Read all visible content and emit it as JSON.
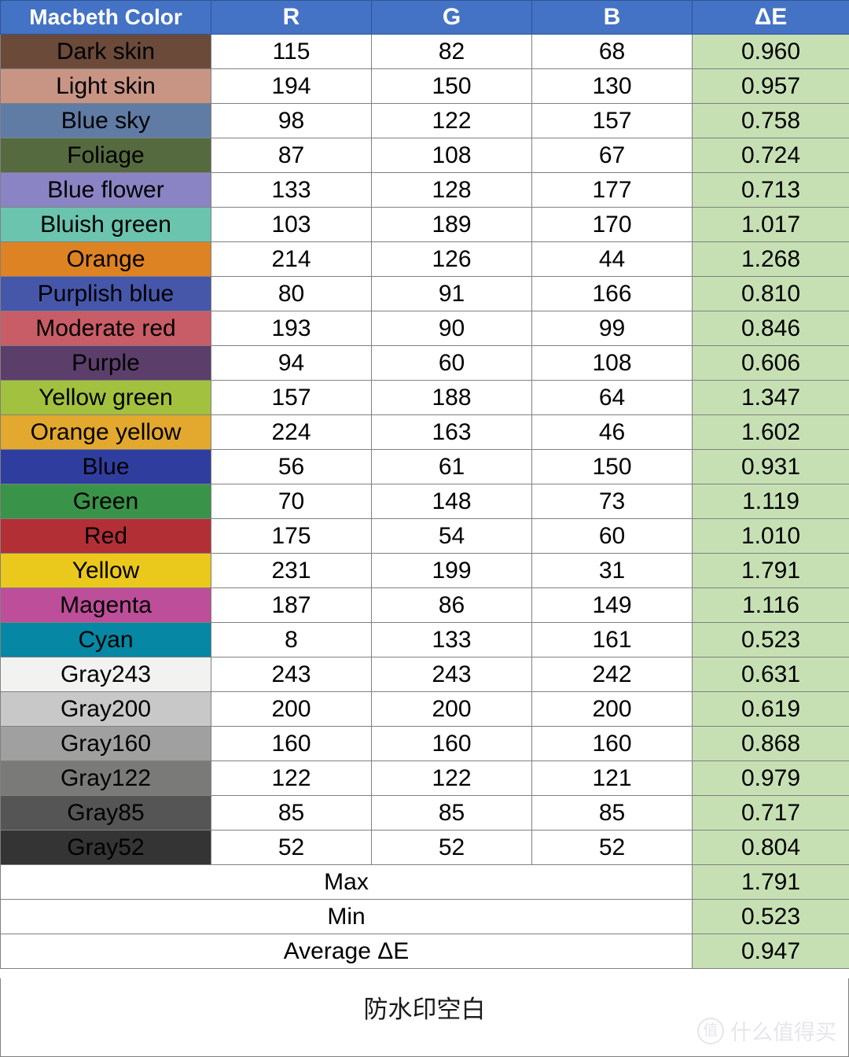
{
  "table": {
    "columns": [
      "Macbeth Color",
      "R",
      "G",
      "B",
      "ΔE"
    ],
    "rows": [
      {
        "name": "Dark skin",
        "swatch": "#6B4A3A",
        "r": "115",
        "g": "82",
        "b": "68",
        "de": "0.960"
      },
      {
        "name": "Light skin",
        "swatch": "#C89585",
        "r": "194",
        "g": "150",
        "b": "130",
        "de": "0.957"
      },
      {
        "name": "Blue sky",
        "swatch": "#607CA4",
        "r": "98",
        "g": "122",
        "b": "157",
        "de": "0.758"
      },
      {
        "name": "Foliage",
        "swatch": "#566A3F",
        "r": "87",
        "g": "108",
        "b": "67",
        "de": "0.724"
      },
      {
        "name": "Blue flower",
        "swatch": "#8B84C4",
        "r": "133",
        "g": "128",
        "b": "177",
        "de": "0.713"
      },
      {
        "name": "Bluish green",
        "swatch": "#6BC4AE",
        "r": "103",
        "g": "189",
        "b": "170",
        "de": "1.017"
      },
      {
        "name": "Orange",
        "swatch": "#DE8323",
        "r": "214",
        "g": "126",
        "b": "44",
        "de": "1.268"
      },
      {
        "name": "Purplish blue",
        "swatch": "#4657AA",
        "r": "80",
        "g": "91",
        "b": "166",
        "de": "0.810"
      },
      {
        "name": "Moderate red",
        "swatch": "#C85C67",
        "r": "193",
        "g": "90",
        "b": "99",
        "de": "0.846"
      },
      {
        "name": "Purple",
        "swatch": "#5C3E6B",
        "r": "94",
        "g": "60",
        "b": "108",
        "de": "0.606"
      },
      {
        "name": "Yellow green",
        "swatch": "#A2C13E",
        "r": "157",
        "g": "188",
        "b": "64",
        "de": "1.347"
      },
      {
        "name": "Orange yellow",
        "swatch": "#E3A82E",
        "r": "224",
        "g": "163",
        "b": "46",
        "de": "1.602"
      },
      {
        "name": "Blue",
        "swatch": "#2F3E9E",
        "r": "56",
        "g": "61",
        "b": "150",
        "de": "0.931"
      },
      {
        "name": "Green",
        "swatch": "#399348",
        "r": "70",
        "g": "148",
        "b": "73",
        "de": "1.119"
      },
      {
        "name": "Red",
        "swatch": "#B32F36",
        "r": "175",
        "g": "54",
        "b": "60",
        "de": "1.010"
      },
      {
        "name": "Yellow",
        "swatch": "#EBC81C",
        "r": "231",
        "g": "199",
        "b": "31",
        "de": "1.791"
      },
      {
        "name": "Magenta",
        "swatch": "#BD4E99",
        "r": "187",
        "g": "86",
        "b": "149",
        "de": "1.116"
      },
      {
        "name": "Cyan",
        "swatch": "#0687A4",
        "r": "8",
        "g": "133",
        "b": "161",
        "de": "0.523"
      },
      {
        "name": "Gray243",
        "swatch": "#F2F2F0",
        "r": "243",
        "g": "243",
        "b": "242",
        "de": "0.631"
      },
      {
        "name": "Gray200",
        "swatch": "#C8C8C8",
        "r": "200",
        "g": "200",
        "b": "200",
        "de": "0.619"
      },
      {
        "name": "Gray160",
        "swatch": "#A0A0A0",
        "r": "160",
        "g": "160",
        "b": "160",
        "de": "0.868"
      },
      {
        "name": "Gray122",
        "swatch": "#7A7A79",
        "r": "122",
        "g": "122",
        "b": "121",
        "de": "0.979"
      },
      {
        "name": "Gray85",
        "swatch": "#555555",
        "r": "85",
        "g": "85",
        "b": "85",
        "de": "0.717"
      },
      {
        "name": "Gray52",
        "swatch": "#343434",
        "r": "52",
        "g": "52",
        "b": "52",
        "de": "0.804"
      }
    ],
    "summary": [
      {
        "label": "Max",
        "value": "1.791"
      },
      {
        "label": "Min",
        "value": "0.523"
      },
      {
        "label": "Average ΔE",
        "value": "0.947"
      }
    ]
  },
  "footer": {
    "note": "防水印空白"
  },
  "watermark": {
    "badge": "值",
    "text": "什么值得买"
  },
  "colors": {
    "header_blue": "#4472C4",
    "de_green": "#C6E0B4",
    "grid_line": "#808080"
  }
}
